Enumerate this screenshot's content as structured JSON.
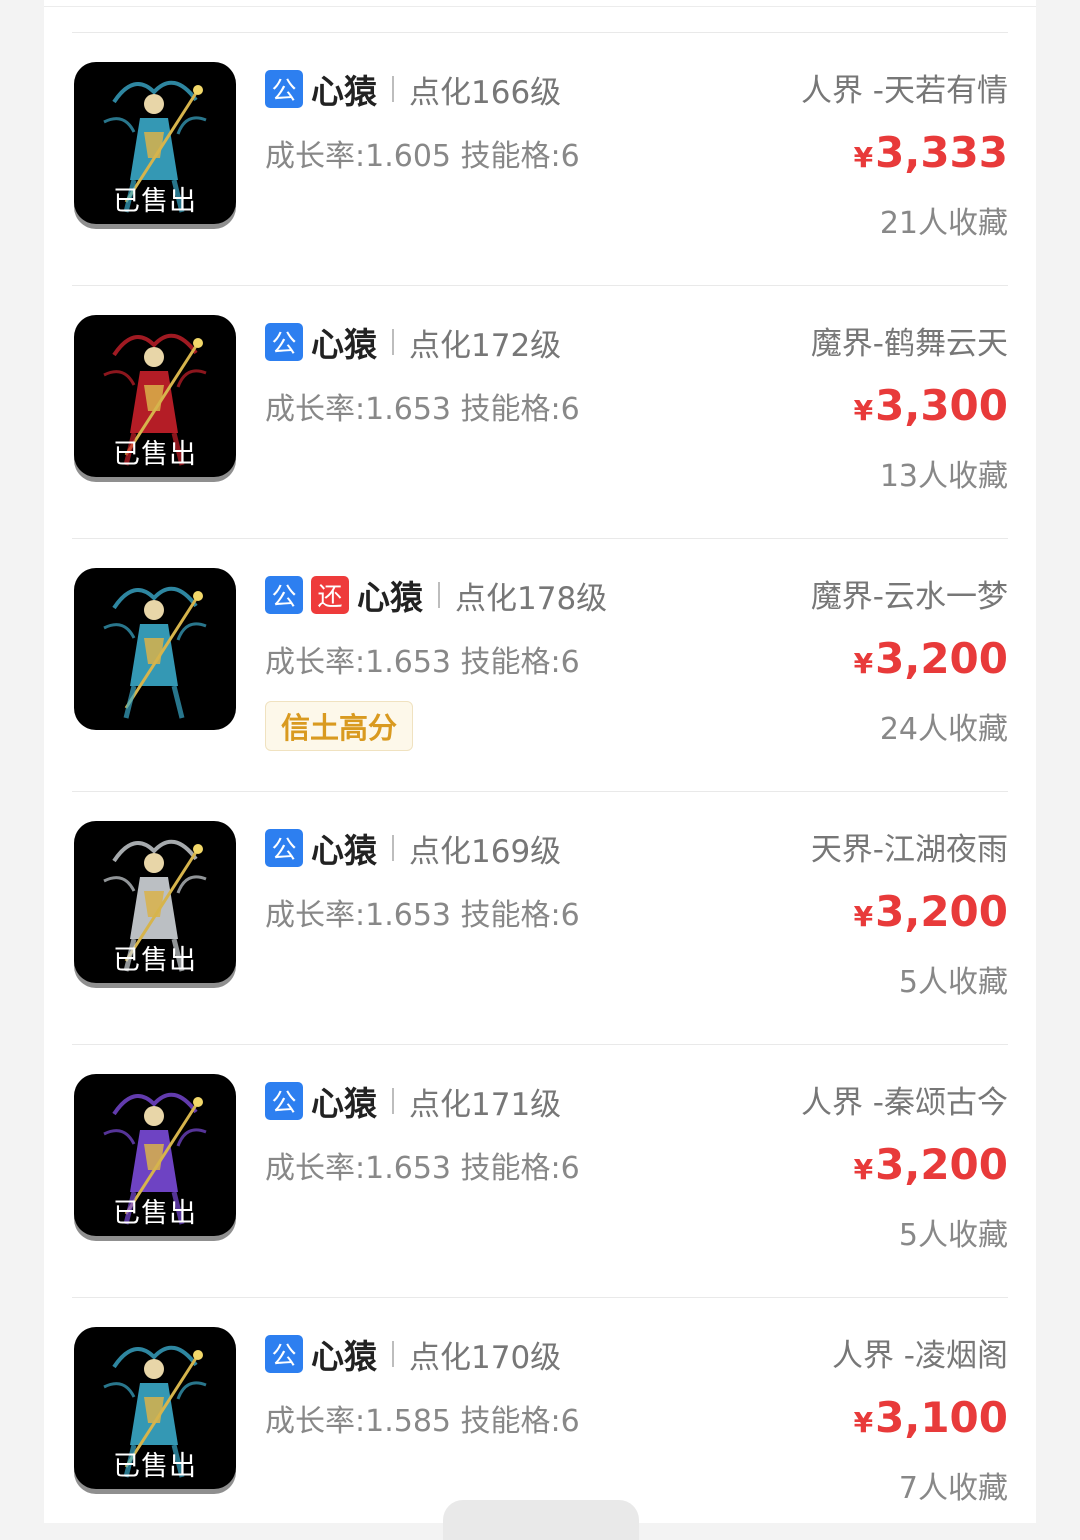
{
  "listings": [
    {
      "pub_badge": "公",
      "return_badge": null,
      "name": "心猿",
      "level": "点化166级",
      "stats": "成长率:1.605 技能格:6",
      "tag": null,
      "server": "人界 -天若有情",
      "currency": "¥",
      "price": "3,333",
      "favorites": "21人收藏",
      "sold_label": "已售出",
      "robe_color": "#3aa8c8"
    },
    {
      "pub_badge": "公",
      "return_badge": null,
      "name": "心猿",
      "level": "点化172级",
      "stats": "成长率:1.653 技能格:6",
      "tag": null,
      "server": "魔界-鹤舞云天",
      "currency": "¥",
      "price": "3,300",
      "favorites": "13人收藏",
      "sold_label": "已售出",
      "robe_color": "#c8202a"
    },
    {
      "pub_badge": "公",
      "return_badge": "还",
      "name": "心猿",
      "level": "点化178级",
      "stats": "成长率:1.653 技能格:6",
      "tag": "信土高分",
      "server": "魔界-云水一梦",
      "currency": "¥",
      "price": "3,200",
      "favorites": "24人收藏",
      "sold_label": null,
      "robe_color": "#3aa8c8"
    },
    {
      "pub_badge": "公",
      "return_badge": null,
      "name": "心猿",
      "level": "点化169级",
      "stats": "成长率:1.653 技能格:6",
      "tag": null,
      "server": "天界-江湖夜雨",
      "currency": "¥",
      "price": "3,200",
      "favorites": "5人收藏",
      "sold_label": "已售出",
      "robe_color": "#cfd4d8"
    },
    {
      "pub_badge": "公",
      "return_badge": null,
      "name": "心猿",
      "level": "点化171级",
      "stats": "成长率:1.653 技能格:6",
      "tag": null,
      "server": "人界 -秦颂古今",
      "currency": "¥",
      "price": "3,200",
      "favorites": "5人收藏",
      "sold_label": "已售出",
      "robe_color": "#7a4ad8"
    },
    {
      "pub_badge": "公",
      "return_badge": null,
      "name": "心猿",
      "level": "点化170级",
      "stats": "成长率:1.585 技能格:6",
      "tag": null,
      "server": "人界 -凌烟阁",
      "currency": "¥",
      "price": "3,100",
      "favorites": "7人收藏",
      "sold_label": "已售出",
      "robe_color": "#3aa8c8"
    }
  ]
}
